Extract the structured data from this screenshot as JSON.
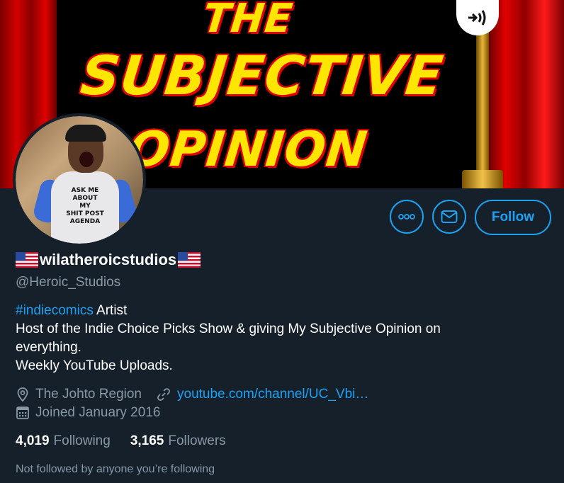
{
  "banner": {
    "title_line1": "THE",
    "title_line2": "SUBJECTIVE",
    "title_line3": "OPINION"
  },
  "avatar": {
    "shirt_text": [
      "ASK ME",
      "ABOUT",
      "MY",
      "SHIT POST",
      "AGENDA"
    ]
  },
  "actions": {
    "more_icon": "more-horizontal-icon",
    "message_icon": "mail-icon",
    "follow_label": "Follow"
  },
  "profile": {
    "display_name": "wilatheroicstudios",
    "handle": "@Heroic_Studios",
    "bio": {
      "hashtag": "#indiecomics",
      "line1_rest": " Artist",
      "line2": "Host of the Indie Choice Picks Show & giving My Subjective Opinion on",
      "line3": "everything.",
      "line4": "Weekly YouTube Uploads."
    },
    "location": "The Johto Region",
    "website": "youtube.com/channel/UC_Vbi…",
    "joined": "Joined January 2016",
    "following_count": "4,019",
    "following_label": "Following",
    "followers_count": "3,165",
    "followers_label": "Followers",
    "followed_note": "Not followed by anyone you’re following"
  },
  "colors": {
    "background": "#15202b",
    "accent": "#1da1f2",
    "secondary_text": "#8899a6"
  }
}
